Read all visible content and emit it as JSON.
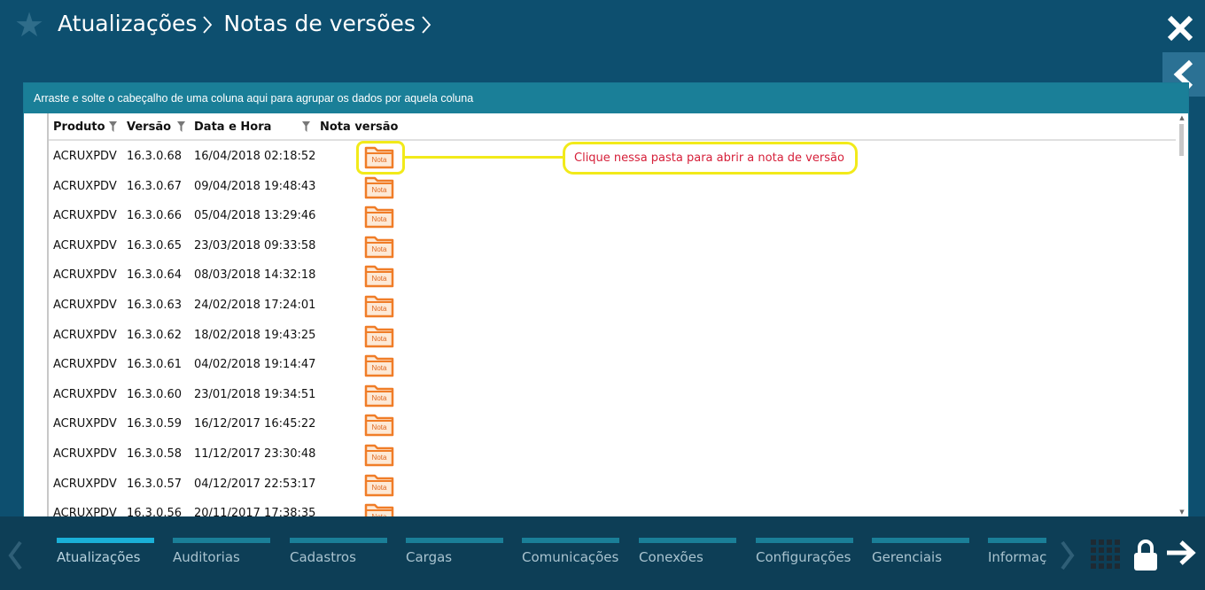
{
  "header": {
    "breadcrumb": [
      {
        "label": "Atualizações"
      },
      {
        "label": "Notas de versões"
      }
    ]
  },
  "panel": {
    "group_hint": "Arraste e solte o cabeçalho de uma coluna aqui para agrupar os dados por aquela coluna",
    "columns": [
      "Produto",
      "Versão",
      "Data e Hora",
      "Nota versão"
    ],
    "folder_label": "Nota",
    "callout": "Clique nessa pasta para abrir a nota de versão",
    "rows": [
      {
        "produto": "ACRUXPDV",
        "versao": "16.3.0.68",
        "data": "16/04/2018 02:18:52"
      },
      {
        "produto": "ACRUXPDV",
        "versao": "16.3.0.67",
        "data": "09/04/2018 19:48:43"
      },
      {
        "produto": "ACRUXPDV",
        "versao": "16.3.0.66",
        "data": "05/04/2018 13:29:46"
      },
      {
        "produto": "ACRUXPDV",
        "versao": "16.3.0.65",
        "data": "23/03/2018 09:33:58"
      },
      {
        "produto": "ACRUXPDV",
        "versao": "16.3.0.64",
        "data": "08/03/2018 14:32:18"
      },
      {
        "produto": "ACRUXPDV",
        "versao": "16.3.0.63",
        "data": "24/02/2018 17:24:01"
      },
      {
        "produto": "ACRUXPDV",
        "versao": "16.3.0.62",
        "data": "18/02/2018 19:43:25"
      },
      {
        "produto": "ACRUXPDV",
        "versao": "16.3.0.61",
        "data": "04/02/2018 19:14:47"
      },
      {
        "produto": "ACRUXPDV",
        "versao": "16.3.0.60",
        "data": "23/01/2018 19:34:51"
      },
      {
        "produto": "ACRUXPDV",
        "versao": "16.3.0.59",
        "data": "16/12/2017 16:45:22"
      },
      {
        "produto": "ACRUXPDV",
        "versao": "16.3.0.58",
        "data": "11/12/2017 23:30:48"
      },
      {
        "produto": "ACRUXPDV",
        "versao": "16.3.0.57",
        "data": "04/12/2017 22:53:17"
      },
      {
        "produto": "ACRUXPDV",
        "versao": "16.3.0.56",
        "data": "20/11/2017 17:38:35"
      }
    ]
  },
  "nav": {
    "items": [
      {
        "label": "Atualizações",
        "active": true
      },
      {
        "label": "Auditorias"
      },
      {
        "label": "Cadastros"
      },
      {
        "label": "Cargas"
      },
      {
        "label": "Comunicações"
      },
      {
        "label": "Conexões"
      },
      {
        "label": "Configurações"
      },
      {
        "label": "Gerenciais"
      },
      {
        "label": "Informações"
      }
    ]
  },
  "icons": {
    "header": [
      "star-icon",
      "close-icon",
      "chevron-left-icon"
    ],
    "nav": [
      "chevron-left-icon",
      "chevron-right-icon",
      "grid-icon",
      "lock-icon",
      "arrow-right-icon"
    ]
  },
  "colors": {
    "background": "#0d4f6f",
    "nav_background": "#0d3e56",
    "group_bar": "#1a7f98",
    "highlight": "#f2ea1a",
    "callout_text": "#d6203a",
    "folder": "#f07d28"
  }
}
